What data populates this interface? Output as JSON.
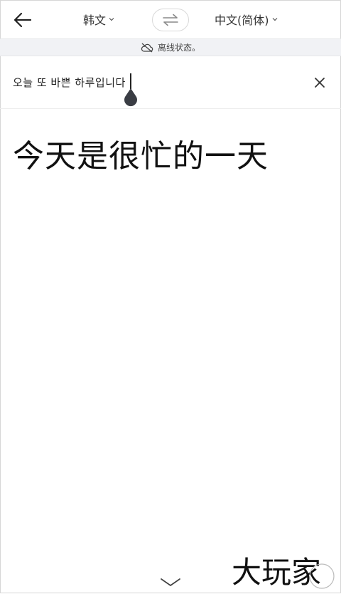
{
  "header": {
    "source_lang": "韩文",
    "target_lang": "中文(简体)"
  },
  "banner": {
    "text": "离线状态。"
  },
  "input": {
    "text": "오늘 또 바쁜 하루입니다"
  },
  "result": {
    "text": "今天是很忙的一天"
  },
  "watermark": {
    "text": "大玩家"
  }
}
